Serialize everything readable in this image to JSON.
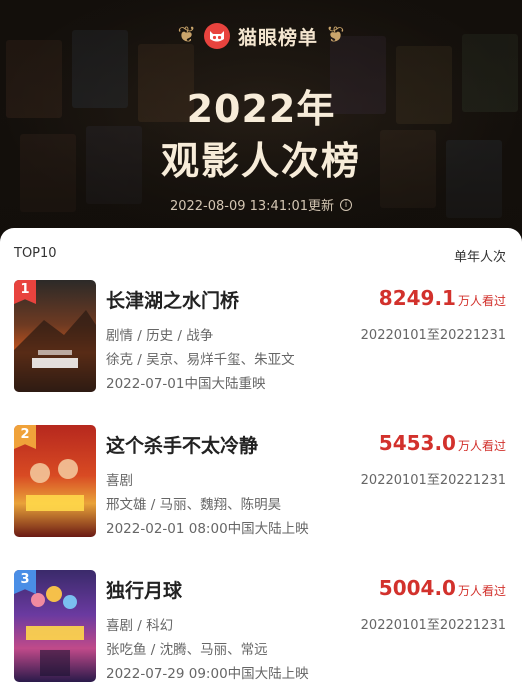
{
  "brand": {
    "name": "猫眼榜单"
  },
  "header": {
    "title_year": "2022年",
    "title_main": "观影人次榜",
    "updated": "2022-08-09 13:41:01更新"
  },
  "list": {
    "left_label": "TOP10",
    "right_label": "单年人次",
    "items": [
      {
        "rank": "1",
        "title": "长津湖之水门桥",
        "genres": "剧情 / 历史 / 战争",
        "cast": "徐克 / 吴京、易烊千玺、朱亚文",
        "release": "2022-07-01中国大陆重映",
        "value": "8249.1",
        "unit": "万人看过",
        "range": "20220101至20221231",
        "badge_color": "#e8433e"
      },
      {
        "rank": "2",
        "title": "这个杀手不太冷静",
        "genres": "喜剧",
        "cast": "邢文雄 / 马丽、魏翔、陈明昊",
        "release": "2022-02-01 08:00中国大陆上映",
        "value": "5453.0",
        "unit": "万人看过",
        "range": "20220101至20221231",
        "badge_color": "#f0a23a"
      },
      {
        "rank": "3",
        "title": "独行月球",
        "genres": "喜剧 / 科幻",
        "cast": "张吃鱼 / 沈腾、马丽、常远",
        "release": "2022-07-29 09:00中国大陆上映",
        "value": "5004.0",
        "unit": "万人看过",
        "range": "20220101至20221231",
        "badge_color": "#4a8ee6"
      }
    ]
  }
}
